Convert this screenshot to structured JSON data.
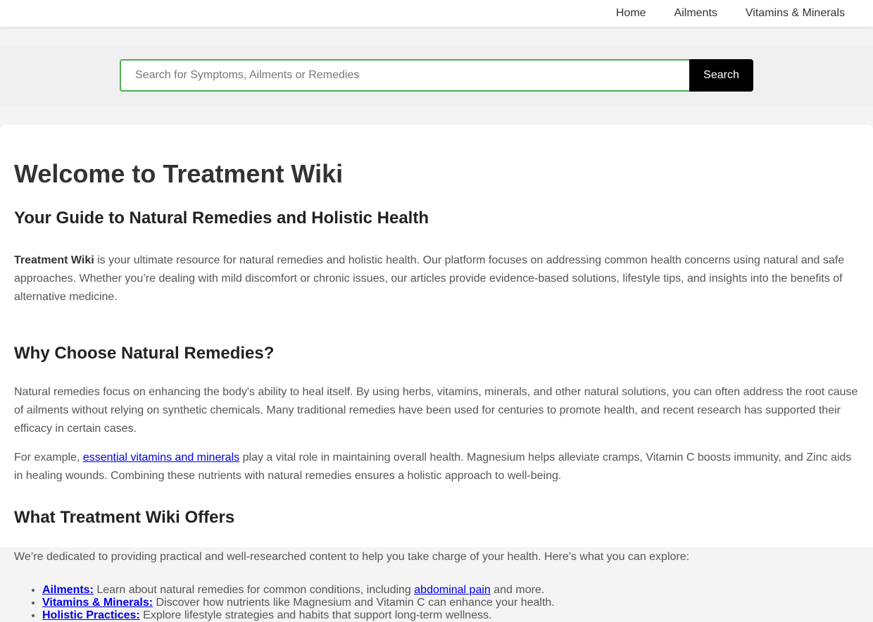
{
  "nav": {
    "home": "Home",
    "ailments": "Ailments",
    "vitamins": "Vitamins & Minerals"
  },
  "search": {
    "placeholder": "Search for Symptoms, Ailments or Remedies",
    "button": "Search"
  },
  "main": {
    "title": "Welcome to Treatment Wiki",
    "subtitle": "Your Guide to Natural Remedies and Holistic Health",
    "intro_bold": "Treatment Wiki",
    "intro_rest": " is your ultimate resource for natural remedies and holistic health. Our platform focuses on addressing common health concerns using natural and safe approaches. Whether you’re dealing with mild discomfort or chronic issues, our articles provide evidence-based solutions, lifestyle tips, and insights into the benefits of alternative medicine.",
    "why_heading": "Why Choose Natural Remedies?",
    "why_p1": "Natural remedies focus on enhancing the body's ability to heal itself. By using herbs, vitamins, minerals, and other natural solutions, you can often address the root cause of ailments without relying on synthetic chemicals. Many traditional remedies have been used for centuries to promote health, and recent research has supported their efficacy in certain cases.",
    "why_p2_pre": "For example, ",
    "why_p2_link": "essential vitamins and minerals",
    "why_p2_post": " play a vital role in maintaining overall health. Magnesium helps alleviate cramps, Vitamin C boosts immunity, and Zinc aids in healing wounds. Combining these nutrients with natural remedies ensures a holistic approach to well-being.",
    "offers_heading": "What Treatment Wiki Offers",
    "offers_intro": "We’re dedicated to providing practical and well-researched content to help you take charge of your health. Here’s what you can explore:",
    "list": [
      {
        "label": "Ailments:",
        "pre": " Learn about natural remedies for common conditions, including ",
        "link": "abdominal pain",
        "post": " and more."
      },
      {
        "label": "Vitamins & Minerals:",
        "pre": " Discover how nutrients like Magnesium and Vitamin C can enhance your health.",
        "link": "",
        "post": ""
      },
      {
        "label": "Holistic Practices:",
        "pre": " Explore lifestyle strategies and habits that support long-term wellness.",
        "link": "",
        "post": ""
      }
    ]
  }
}
